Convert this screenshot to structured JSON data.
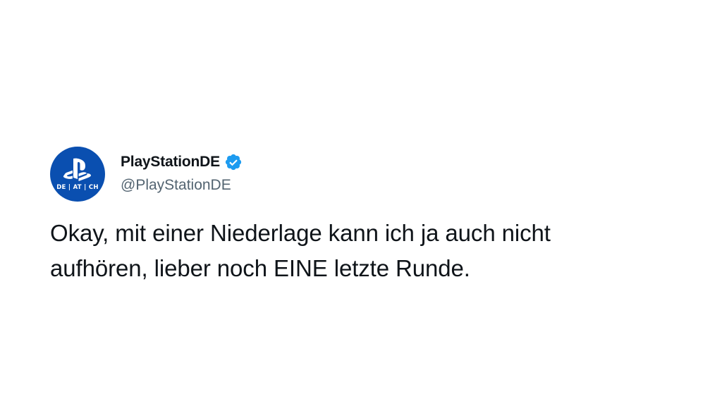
{
  "tweet": {
    "author": {
      "display_name": "PlayStationDE",
      "handle": "@PlayStationDE",
      "verified": true,
      "avatar": {
        "icon": "playstation-logo-icon",
        "region_label": "DE | AT | CH",
        "background_color": "#0a4fb0"
      }
    },
    "text_lines": [
      "Okay, mit einer Niederlage kann ich ja auch nicht",
      "aufhören, lieber noch EINE letzte Runde."
    ]
  },
  "colors": {
    "text_primary": "#0f1419",
    "text_secondary": "#536471",
    "verified_badge": "#1d9bf0",
    "background": "#ffffff"
  }
}
